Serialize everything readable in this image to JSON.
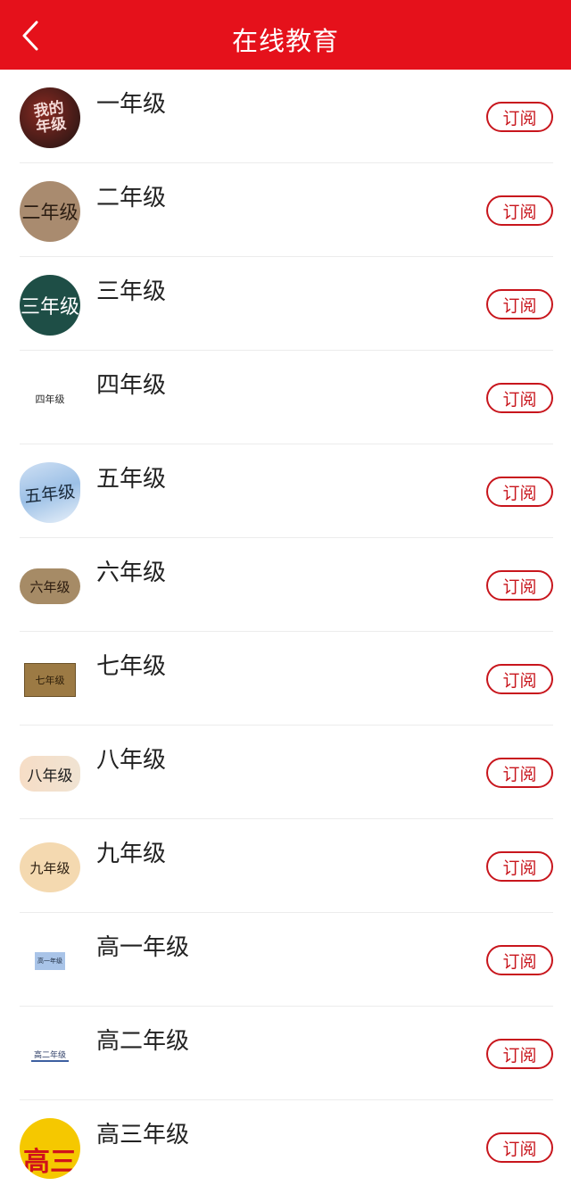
{
  "header": {
    "title": "在线教育",
    "accent_color": "#e5111b"
  },
  "subscribe_color": "#c8161d",
  "items": [
    {
      "label": "一年级",
      "thumb_text": "我的\n年级",
      "button": "订阅"
    },
    {
      "label": "二年级",
      "thumb_text": "二年级",
      "button": "订阅"
    },
    {
      "label": "三年级",
      "thumb_text": "三年级",
      "button": "订阅"
    },
    {
      "label": "四年级",
      "thumb_text": "四年级",
      "button": "订阅"
    },
    {
      "label": "五年级",
      "thumb_text": "五年级",
      "button": "订阅"
    },
    {
      "label": "六年级",
      "thumb_text": "六年级",
      "button": "订阅"
    },
    {
      "label": "七年级",
      "thumb_text": "七年级",
      "button": "订阅"
    },
    {
      "label": "八年级",
      "thumb_text": "八年级",
      "button": "订阅"
    },
    {
      "label": "九年级",
      "thumb_text": "九年级",
      "button": "订阅"
    },
    {
      "label": "高一年级",
      "thumb_text": "高一年级",
      "button": "订阅"
    },
    {
      "label": "高二年级",
      "thumb_text": "高二年级",
      "button": "订阅"
    },
    {
      "label": "高三年级",
      "thumb_text": "高三",
      "button": "订阅"
    }
  ]
}
